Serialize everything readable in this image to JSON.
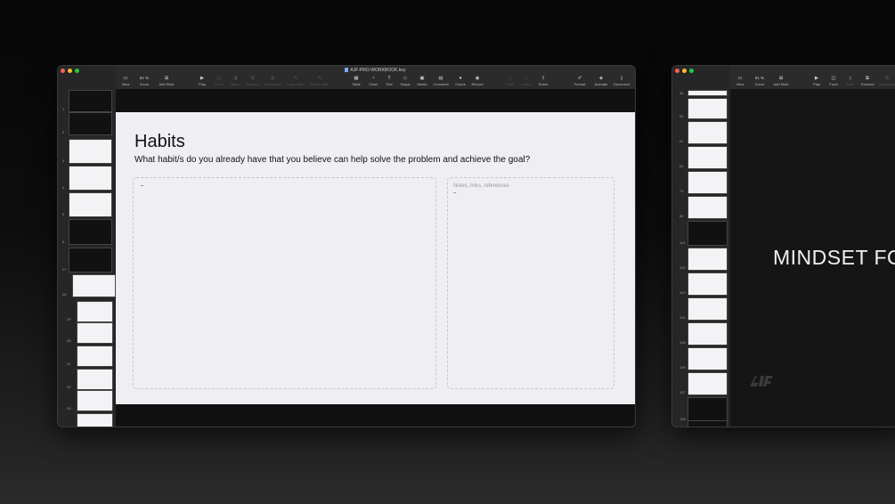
{
  "window1": {
    "title": "AJF-PRO-WORKBOOK.key",
    "toolbar": [
      {
        "label": "View",
        "icon": "view-icon",
        "dim": false
      },
      {
        "label": "Zoom",
        "icon": "zoom-icon",
        "dim": false,
        "value": "81 %"
      },
      {
        "label": "Add Slide",
        "icon": "add-slide-icon",
        "dim": false
      },
      {
        "label": "Play",
        "icon": "play-icon",
        "dim": false
      },
      {
        "label": "Front",
        "icon": "front-icon",
        "dim": true
      },
      {
        "label": "Back",
        "icon": "back-icon",
        "dim": true
      },
      {
        "label": "Forward",
        "icon": "forward-icon",
        "dim": true
      },
      {
        "label": "Backward",
        "icon": "backward-icon",
        "dim": true
      },
      {
        "label": "Copy Style",
        "icon": "copy-style-icon",
        "dim": true
      },
      {
        "label": "Paste Style",
        "icon": "paste-style-icon",
        "dim": true
      },
      {
        "label": "Table",
        "icon": "table-icon",
        "dim": false
      },
      {
        "label": "Chart",
        "icon": "chart-icon",
        "dim": false
      },
      {
        "label": "Text",
        "icon": "text-icon",
        "dim": false
      },
      {
        "label": "Shape",
        "icon": "shape-icon",
        "dim": false
      },
      {
        "label": "Media",
        "icon": "media-icon",
        "dim": false
      },
      {
        "label": "Comment",
        "icon": "comment-icon",
        "dim": false
      },
      {
        "label": "Colors",
        "icon": "colors-icon",
        "dim": false
      },
      {
        "label": "Record",
        "icon": "record-icon",
        "dim": false
      },
      {
        "label": "Lock",
        "icon": "lock-icon",
        "dim": true
      },
      {
        "label": "Unlock",
        "icon": "unlock-icon",
        "dim": true
      },
      {
        "label": "Share",
        "icon": "share-icon",
        "dim": false
      },
      {
        "label": "Format",
        "icon": "format-icon",
        "dim": false
      },
      {
        "label": "Animate",
        "icon": "animate-icon",
        "dim": false
      },
      {
        "label": "Document",
        "icon": "document-icon",
        "dim": false
      }
    ],
    "slide_numbers": [
      "1",
      "2",
      "3",
      "4",
      "5",
      "6",
      "27",
      "28",
      "29",
      "30",
      "31",
      "32",
      "33",
      "34"
    ],
    "slide": {
      "title": "Habits",
      "subtitle": "What habit/s do you already have that you believe can help solve the problem and achieve the goal?",
      "box1_text": "–",
      "box2_placeholder": "Notes, links, references",
      "box2_text": "–"
    }
  },
  "window2": {
    "toolbar": [
      {
        "label": "View",
        "icon": "view-icon",
        "dim": false
      },
      {
        "label": "Zoom",
        "icon": "zoom-icon",
        "dim": false,
        "value": "81 %"
      },
      {
        "label": "Add Slide",
        "icon": "add-slide-icon",
        "dim": false
      },
      {
        "label": "Play",
        "icon": "play-icon",
        "dim": false
      },
      {
        "label": "Front",
        "icon": "front-icon",
        "dim": false
      },
      {
        "label": "Back",
        "icon": "back-icon",
        "dim": true
      },
      {
        "label": "Forward",
        "icon": "forward-icon",
        "dim": false
      },
      {
        "label": "Backward",
        "icon": "backward-icon",
        "dim": true
      }
    ],
    "slide_numbers": [
      "46",
      "53",
      "61",
      "62",
      "73",
      "82",
      "101",
      "102",
      "103",
      "104",
      "105",
      "106",
      "107",
      "138",
      "164"
    ],
    "slide_text": "MINDSET FO"
  }
}
